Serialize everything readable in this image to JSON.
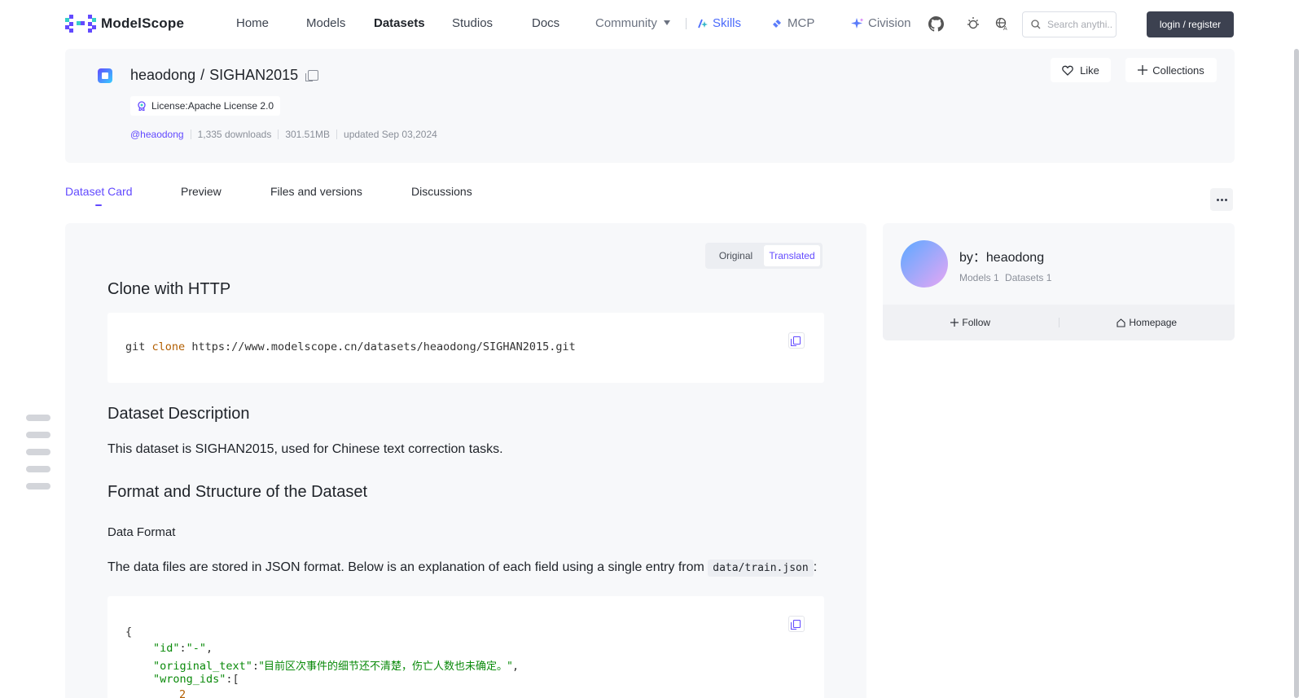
{
  "header": {
    "logo_text": "ModelScope",
    "nav": {
      "home": "Home",
      "models": "Models",
      "datasets": "Datasets",
      "studios": "Studios",
      "docs": "Docs",
      "community": "Community",
      "skills": "Skills",
      "mcp": "MCP",
      "civision": "Civision"
    },
    "search_placeholder": "Search anythi...",
    "login_label": "login / register"
  },
  "dataset": {
    "owner": "heaodong",
    "separator": "/",
    "name": "SIGHAN2015",
    "license": "License:Apache License 2.0",
    "author_handle": "@heaodong",
    "downloads": "1,335 downloads",
    "size": "301.51MB",
    "updated": "updated Sep 03,2024",
    "like_label": "Like",
    "collections_label": "Collections"
  },
  "tabs": {
    "card": "Dataset Card",
    "preview": "Preview",
    "files": "Files and versions",
    "discussions": "Discussions"
  },
  "content": {
    "toggle_original": "Original",
    "toggle_translated": "Translated",
    "clone_heading": "Clone with HTTP",
    "clone_cmd_git": "git",
    "clone_cmd_kw": "clone",
    "clone_cmd_url": "https://www.modelscope.cn/datasets/heaodong/SIGHAN2015.git",
    "desc_heading": "Dataset Description",
    "desc_text": "This dataset is SIGHAN2015, used for Chinese text correction tasks.",
    "format_heading": "Format and Structure of the Dataset",
    "data_format_label": "Data Format",
    "format_text": "The data files are stored in JSON format. Below is an explanation of each field using a single entry from",
    "format_file": "data/train.json",
    "format_colon": ":",
    "json_open": "{",
    "json_id_key": "\"id\"",
    "json_id_val": "\"-\"",
    "json_orig_key": "\"original_text\"",
    "json_orig_val": "\"目前区次事件的细节还不清楚，伤亡人数也未确定。\"",
    "json_wrong_key": "\"wrong_ids\"",
    "json_bracket": "[",
    "json_num": "2"
  },
  "author_card": {
    "by": "by：heaodong",
    "models": "Models 1",
    "datasets": "Datasets 1",
    "follow": "Follow",
    "homepage": "Homepage"
  },
  "colors": {
    "accent": "#624aff",
    "login_bg": "#3c4150",
    "skills": "#4b6bfb"
  }
}
